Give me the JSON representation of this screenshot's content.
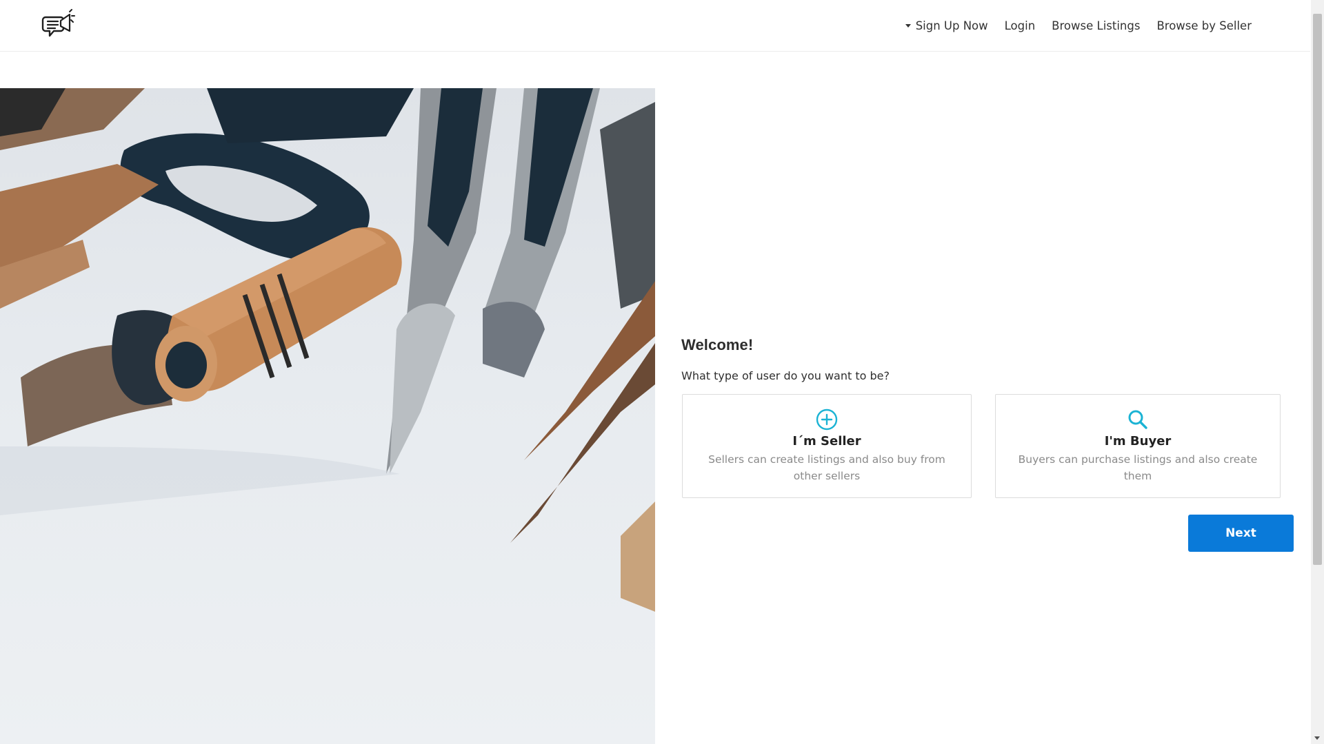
{
  "header": {
    "logo_icon": "megaphone-chat-logo-icon",
    "nav": [
      {
        "label": "Sign Up Now",
        "icon": "caret-down-icon"
      },
      {
        "label": "Login"
      },
      {
        "label": "Browse Listings"
      },
      {
        "label": "Browse by Seller"
      }
    ]
  },
  "hero": {
    "image_subject": "tools-photo"
  },
  "welcome": {
    "title": "Welcome!",
    "subtitle": "What type of user do you want to be?",
    "options": [
      {
        "icon": "plus-circle-icon",
        "title": "I´m Seller",
        "description": "Sellers can create listings and also buy from other sellers"
      },
      {
        "icon": "search-icon",
        "title": "I'm Buyer",
        "description": "Buyers can purchase listings and also create them"
      }
    ],
    "next_label": "Next"
  },
  "colors": {
    "accent_button": "#0a7ad9",
    "icon_cyan": "#1bb3d4",
    "card_border": "#dcdcdc",
    "muted_text": "#8a8a8a"
  }
}
